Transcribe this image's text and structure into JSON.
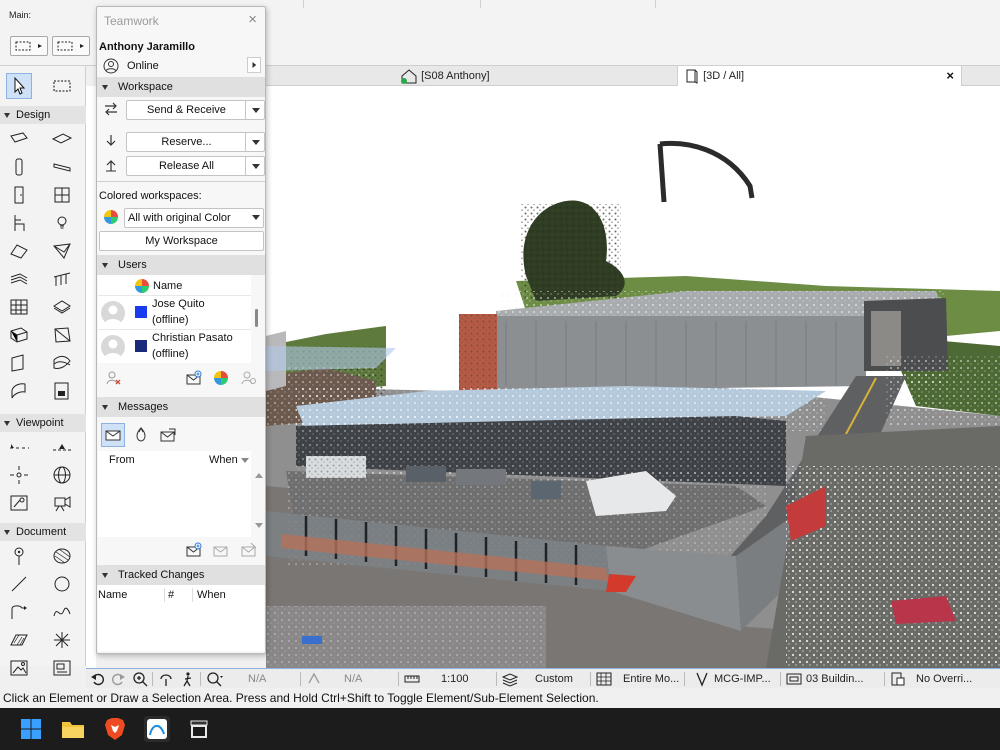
{
  "toolbar": {
    "main_label": "Main:"
  },
  "toolbox": {
    "sections": [
      {
        "label": "Design"
      },
      {
        "label": "Viewpoint"
      },
      {
        "label": "Document"
      }
    ]
  },
  "tabs": [
    {
      "label": "[S08 Anthony]"
    },
    {
      "label": "[3D / All]"
    }
  ],
  "tab_close": "×",
  "teamwork": {
    "title": "Teamwork",
    "close": "×",
    "user_name": "Anthony Jaramillo",
    "status": "Online",
    "workspace_header": "Workspace",
    "send_receive_label": "Send & Receive",
    "reserve_label": "Reserve...",
    "release_all_label": "Release All",
    "colored_workspaces_label": "Colored workspaces:",
    "color_mode_value": "All with original Color",
    "my_workspace_label": "My Workspace",
    "users_header": "Users",
    "users_name_col": "Name",
    "users": [
      {
        "name": "Jose Quito",
        "status": "(offline)",
        "color": "#1a3cf0"
      },
      {
        "name": "Christian Pasato",
        "status": "(offline)",
        "color": "#1a2a7a"
      }
    ],
    "messages_header": "Messages",
    "messages_from_col": "From",
    "messages_when_col": "When",
    "tracked_header": "Tracked Changes",
    "tracked_name_col": "Name",
    "tracked_num_col": "#",
    "tracked_when_col": "When"
  },
  "statusbar": {
    "na1": "N/A",
    "na2": "N/A",
    "scale": "1:100",
    "custom": "Custom",
    "entire_model": "Entire Mo...",
    "mcg": "MCG-IMP...",
    "building": "03 Buildin...",
    "override": "No Overri..."
  },
  "hint": "Click an Element or Draw a Selection Area. Press and Hold Ctrl+Shift to Toggle Element/Sub-Element Selection."
}
